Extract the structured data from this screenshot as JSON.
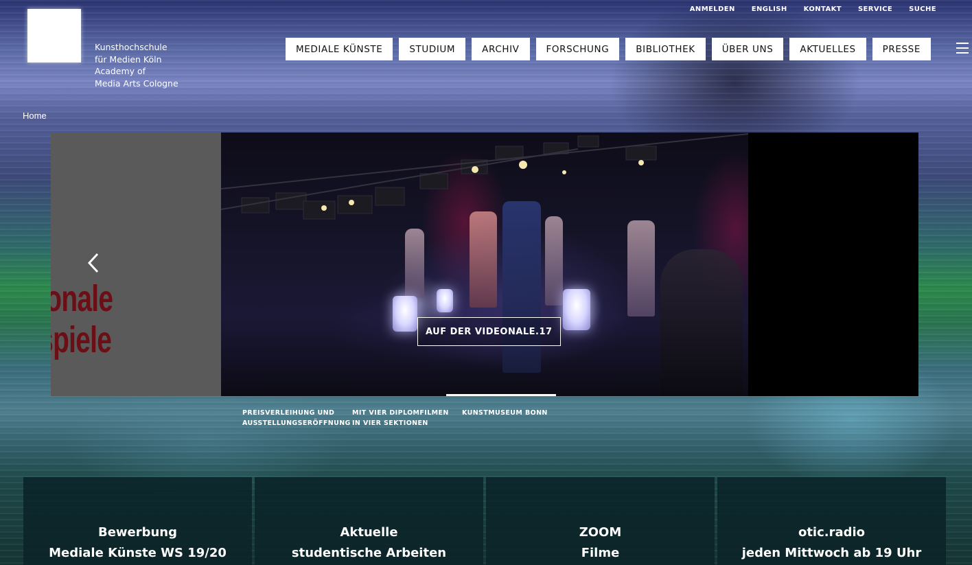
{
  "logo": {
    "tagline": [
      "Kunsthochschule",
      "für Medien Köln",
      "Academy of",
      "Media Arts Cologne"
    ]
  },
  "utility_nav": [
    "ANMELDEN",
    "ENGLISH",
    "KONTAKT",
    "SERVICE",
    "SUCHE"
  ],
  "main_nav": [
    "MEDIALE KÜNSTE",
    "STUDIUM",
    "ARCHIV",
    "FORSCHUNG",
    "BIBLIOTHEK",
    "ÜBER UNS",
    "AKTUELLES",
    "PRESSE"
  ],
  "breadcrumb": "Home",
  "slider": {
    "left_slide_text": [
      "tionale",
      "tspiele"
    ],
    "caption": "AUF DER VIDEONALE.17",
    "thumbnails": [
      [
        "PREISVERLEIHUNG UND",
        "AUSSTELLUNGSERÖFFNUNG"
      ],
      [
        "MIT VIER DIPLOMFILMEN",
        "IN VIER SEKTIONEN"
      ],
      [
        "KUNSTMUSEUM BONN",
        ""
      ]
    ]
  },
  "tiles": [
    [
      "Bewerbung",
      "Mediale Künste WS 19/20"
    ],
    [
      "Aktuelle",
      "studentische Arbeiten"
    ],
    [
      "ZOOM",
      "Filme"
    ],
    [
      "otic.radio",
      "jeden Mittwoch ab 19 Uhr"
    ]
  ]
}
